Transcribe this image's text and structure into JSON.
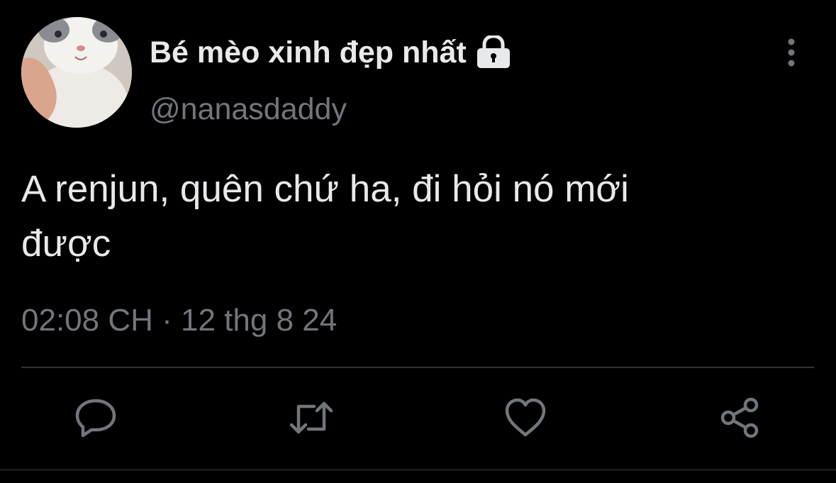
{
  "author": {
    "display_name": "Bé mèo xinh đẹp nhất",
    "handle": "@nanasdaddy",
    "protected_icon": "lock-icon",
    "avatar_icon": "cat-avatar"
  },
  "tweet": {
    "text_line1": "A renjun, quên chứ ha, đi hỏi nó mới",
    "text_line2": "được",
    "time": "02:08 CH",
    "separator": "·",
    "date": "12 thg 8 24"
  },
  "actions": {
    "more": "more-vertical-icon",
    "reply": "reply-icon",
    "retweet": "retweet-icon",
    "like": "heart-icon",
    "share": "share-icon"
  },
  "colors": {
    "background": "#000000",
    "primary_text": "#e7e9ea",
    "secondary_text": "#71767b",
    "divider": "#2f3336",
    "icon": "#71767b"
  }
}
